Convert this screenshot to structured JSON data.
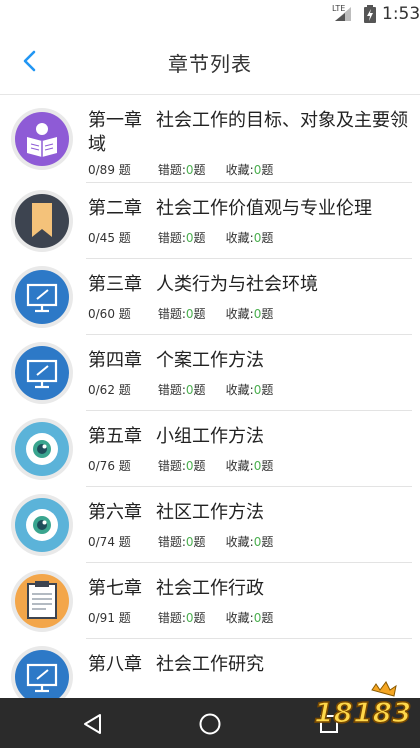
{
  "status_bar": {
    "network": "LTE",
    "time": "1:53"
  },
  "header": {
    "title": "章节列表",
    "back_icon": "chevron-left-icon",
    "accent_color": "#2196f3"
  },
  "chapters": [
    {
      "chapter": "第一章",
      "name": "社会工作的目标、对象及主要领域",
      "progress": "0/89 题",
      "wrong_label": "错题:",
      "wrong_count": "0",
      "wrong_unit": "题",
      "fav_label": "收藏:",
      "fav_count": "0",
      "fav_unit": "题",
      "icon": "reader-icon"
    },
    {
      "chapter": "第二章",
      "name": "社会工作价值观与专业伦理",
      "progress": "0/45 题",
      "wrong_label": "错题:",
      "wrong_count": "0",
      "wrong_unit": "题",
      "fav_label": "收藏:",
      "fav_count": "0",
      "fav_unit": "题",
      "icon": "bookmark-icon"
    },
    {
      "chapter": "第三章",
      "name": "人类行为与社会环境",
      "progress": "0/60 题",
      "wrong_label": "错题:",
      "wrong_count": "0",
      "wrong_unit": "题",
      "fav_label": "收藏:",
      "fav_count": "0",
      "fav_unit": "题",
      "icon": "monitor-icon"
    },
    {
      "chapter": "第四章",
      "name": "个案工作方法",
      "progress": "0/62 题",
      "wrong_label": "错题:",
      "wrong_count": "0",
      "wrong_unit": "题",
      "fav_label": "收藏:",
      "fav_count": "0",
      "fav_unit": "题",
      "icon": "monitor-icon"
    },
    {
      "chapter": "第五章",
      "name": "小组工作方法",
      "progress": "0/76 题",
      "wrong_label": "错题:",
      "wrong_count": "0",
      "wrong_unit": "题",
      "fav_label": "收藏:",
      "fav_count": "0",
      "fav_unit": "题",
      "icon": "eye-icon"
    },
    {
      "chapter": "第六章",
      "name": "社区工作方法",
      "progress": "0/74 题",
      "wrong_label": "错题:",
      "wrong_count": "0",
      "wrong_unit": "题",
      "fav_label": "收藏:",
      "fav_count": "0",
      "fav_unit": "题",
      "icon": "eye-icon"
    },
    {
      "chapter": "第七章",
      "name": "社会工作行政",
      "progress": "0/91 题",
      "wrong_label": "错题:",
      "wrong_count": "0",
      "wrong_unit": "题",
      "fav_label": "收藏:",
      "fav_count": "0",
      "fav_unit": "题",
      "icon": "clipboard-icon"
    },
    {
      "chapter": "第八章",
      "name": "社会工作研究",
      "icon": "monitor-icon"
    }
  ],
  "colors": {
    "count_green": "#4caf50",
    "nav_bar": "#2b2b2b"
  },
  "nav": {
    "back_icon": "triangle-back-icon",
    "home_icon": "circle-home-icon",
    "recents_icon": "square-recents-icon"
  },
  "watermark": {
    "logo_text": "18183",
    "icon": "watermark-logo-icon"
  }
}
